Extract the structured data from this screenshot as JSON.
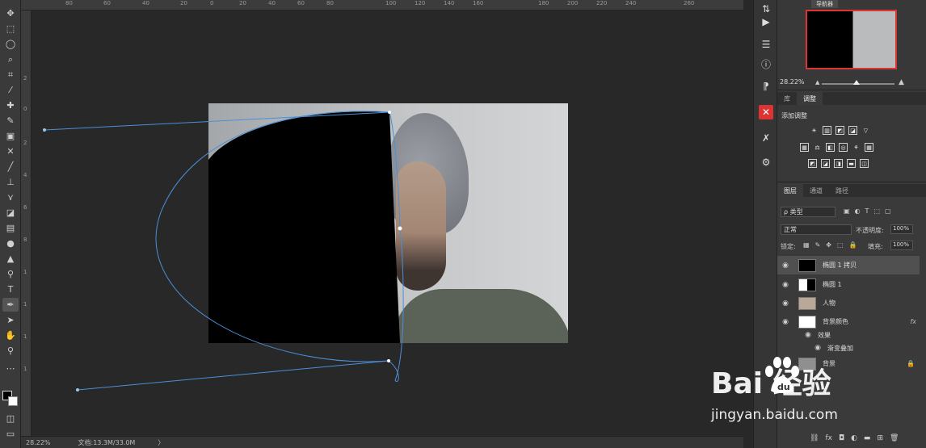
{
  "ruler": {
    "top_numbers": [
      "80",
      "60",
      "40",
      "20",
      "0",
      "20",
      "40",
      "60",
      "80",
      "100",
      "120",
      "140",
      "160",
      "180",
      "200",
      "220",
      "240",
      "260"
    ],
    "left_numbers": [
      "2",
      "0",
      "2",
      "4",
      "6",
      "8",
      "1",
      "0",
      "1",
      "2",
      "1",
      "4",
      "1",
      "6"
    ]
  },
  "status": {
    "zoom": "28.22%",
    "doc_size": "文档:13.3M/33.0M",
    "arrow": "〉"
  },
  "navigator": {
    "tab": "导航器",
    "zoom": "28.22%"
  },
  "adjustments": {
    "tabs": [
      "库",
      "调整"
    ],
    "active_tab": "调整",
    "title": "添加调整"
  },
  "layers_panel": {
    "tabs": [
      "图层",
      "通道",
      "路径"
    ],
    "active_tab": "图层",
    "filter_label": "ρ 类型",
    "blend_mode": "正常",
    "opacity_label": "不透明度:",
    "opacity_value": "100%",
    "lock_label": "锁定:",
    "fill_label": "填充:",
    "fill_value": "100%",
    "layers": [
      {
        "name": "椭圆 1 拷贝",
        "selected": true
      },
      {
        "name": "椭圆 1",
        "selected": false
      },
      {
        "name": "人物",
        "selected": false
      },
      {
        "name": "背景颜色",
        "selected": false,
        "fx": "fx"
      },
      {
        "name": "效果",
        "selected": false,
        "sub": true
      },
      {
        "name": "渐变叠加",
        "selected": false,
        "sub": true
      },
      {
        "name": "背景",
        "selected": false
      }
    ]
  },
  "watermark": {
    "logo_text": "Bai  经验",
    "url": "jingyan.baidu.com"
  },
  "colors": {
    "accent_selection": "#d33333",
    "path": "#4a90d9"
  }
}
